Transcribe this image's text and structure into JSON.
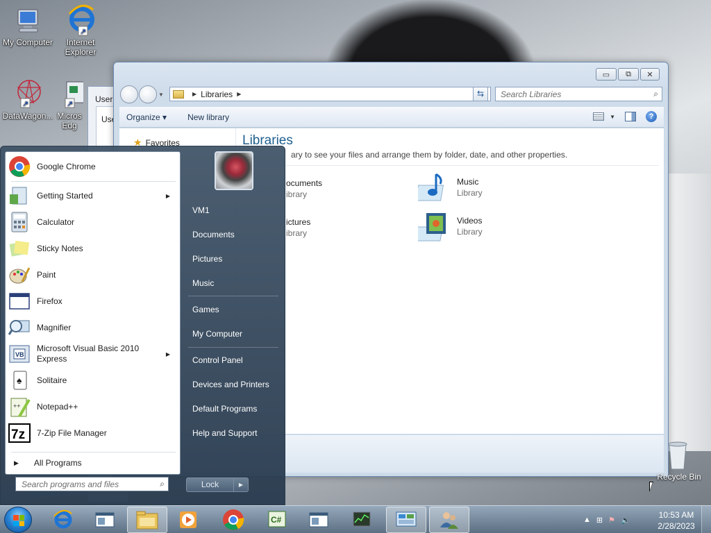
{
  "desktop": {
    "icons": [
      {
        "label": "My Computer"
      },
      {
        "label": "Internet Explorer"
      },
      {
        "label": "DataWagon..."
      },
      {
        "label": "Micros Edg"
      },
      {
        "label": "Recycle Bin"
      }
    ],
    "back_window": {
      "title": "User",
      "field": "Use"
    }
  },
  "explorer": {
    "address": {
      "crumb": "Libraries"
    },
    "search_placeholder": "Search Libraries",
    "toolbar": {
      "organize": "Organize",
      "new_library": "New library"
    },
    "nav_pane": {
      "favorites": "Favorites"
    },
    "heading": "Libraries",
    "subheading": "Open a library to see your files and arrange them by folder, date, and other properties.",
    "subheading_visible": "ary to see your files and arrange them by folder, date, and other properties.",
    "libraries": [
      {
        "name": "ocuments",
        "type": "ibrary"
      },
      {
        "name": "Music",
        "type": "Library"
      },
      {
        "name": "ictures",
        "type": "ibrary"
      },
      {
        "name": "Videos",
        "type": "Library"
      }
    ]
  },
  "start_menu": {
    "programs": [
      {
        "label": "Google Chrome",
        "icon": "chrome-icon",
        "submenu": false
      },
      {
        "label": "Getting Started",
        "icon": "getting-started-icon",
        "submenu": true
      },
      {
        "label": "Calculator",
        "icon": "calculator-icon",
        "submenu": false
      },
      {
        "label": "Sticky Notes",
        "icon": "sticky-notes-icon",
        "submenu": false
      },
      {
        "label": "Paint",
        "icon": "paint-icon",
        "submenu": false
      },
      {
        "label": "Firefox",
        "icon": "firefox-icon",
        "submenu": false
      },
      {
        "label": "Magnifier",
        "icon": "magnifier-icon",
        "submenu": false
      },
      {
        "label": "Microsoft Visual Basic 2010 Express",
        "label_line1": "Microsoft Visual Basic 2010",
        "label_line2": "Express",
        "icon": "visual-basic-icon",
        "submenu": true
      },
      {
        "label": "Solitaire",
        "icon": "solitaire-icon",
        "submenu": false
      },
      {
        "label": "Notepad++",
        "icon": "notepad-plus-plus-icon",
        "submenu": false
      },
      {
        "label": "7-Zip File Manager",
        "icon": "7zip-icon",
        "submenu": false
      }
    ],
    "all_programs": "All Programs",
    "search_placeholder": "Search programs and files",
    "right_items": {
      "user": "VM1",
      "documents": "Documents",
      "pictures": "Pictures",
      "music": "Music",
      "games": "Games",
      "computer": "My Computer",
      "control_panel": "Control Panel",
      "devices": "Devices and Printers",
      "defaults": "Default Programs",
      "help": "Help and Support"
    },
    "lock_label": "Lock"
  },
  "taskbar": {
    "pinned": [
      "internet-explorer-icon",
      "window-icon",
      "file-explorer-icon",
      "media-player-icon",
      "chrome-icon",
      "csharp-icon",
      "window-icon",
      "task-manager-icon",
      "control-panel-icon",
      "users-icon"
    ],
    "clock_time": "10:53 AM",
    "clock_date": "2/28/2023"
  },
  "colors": {
    "title_green": "#1e5f8f",
    "taskbar": "#5a6e82"
  }
}
